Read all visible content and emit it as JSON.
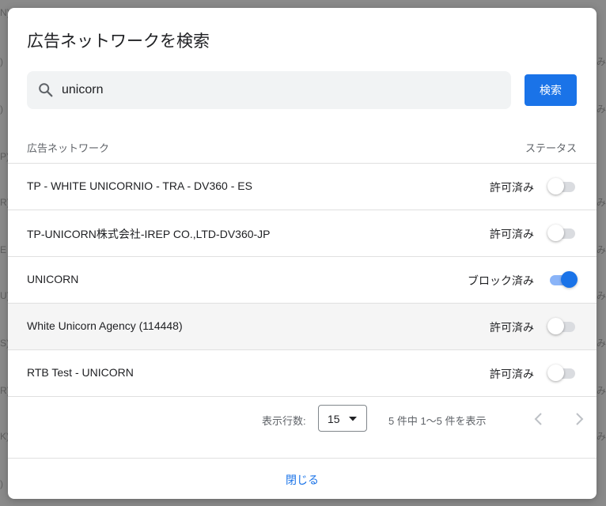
{
  "dialog": {
    "title": "広告ネットワークを検索",
    "search": {
      "value": "unicorn",
      "button_label": "検索"
    },
    "table": {
      "columns": {
        "network": "広告ネットワーク",
        "status": "ステータス"
      },
      "rows": [
        {
          "name": "TP - WHITE UNICORNIO - TRA - DV360 - ES",
          "status": "許可済み",
          "blocked": false
        },
        {
          "name": "TP-UNICORN株式会社-IREP CO.,LTD-DV360-JP",
          "status": "許可済み",
          "blocked": false
        },
        {
          "name": "UNICORN",
          "status": "ブロック済み",
          "blocked": true
        },
        {
          "name": "White Unicorn Agency (114448)",
          "status": "許可済み",
          "blocked": false
        },
        {
          "name": "RTB Test - UNICORN",
          "status": "許可済み",
          "blocked": false
        }
      ]
    },
    "pagination": {
      "rows_per_page_label": "表示行数:",
      "rows_per_page": "15",
      "range_text": "5 件中 1〜5 件を表示"
    },
    "close_label": "閉じる"
  },
  "colors": {
    "accent": "#1a73e8",
    "toggle_on_track": "#8ab4f8",
    "toggle_off_track": "#dadce0",
    "backdrop": "#8a8a8a"
  }
}
